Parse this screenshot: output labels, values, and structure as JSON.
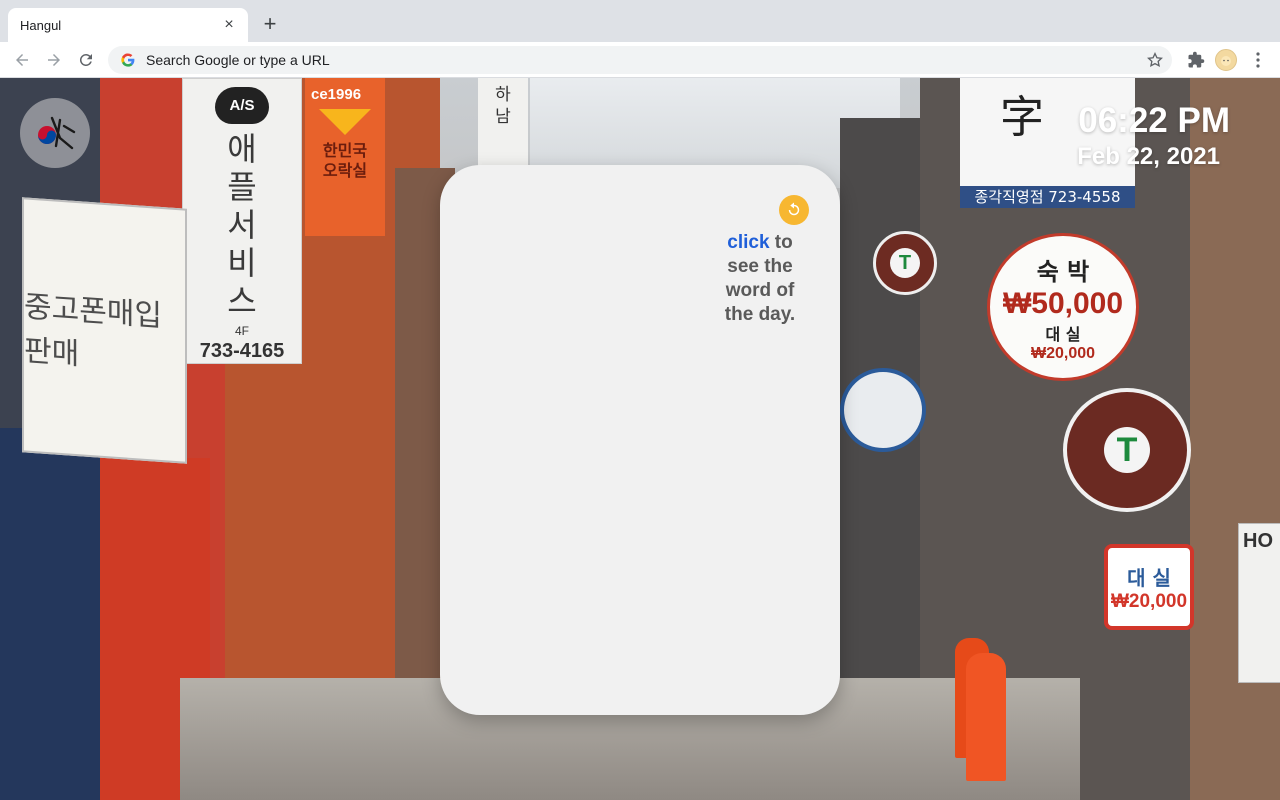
{
  "tab": {
    "title": "Hangul",
    "close_glyph": "×",
    "new_tab_glyph": "+"
  },
  "omnibox": {
    "placeholder": "Search Google or type a URL"
  },
  "toolbar_icons": [
    "back-icon",
    "forward-icon",
    "reload-icon",
    "google-g-icon",
    "star-icon",
    "puzzle-icon",
    "avatar",
    "menu-dots-icon"
  ],
  "colors": {
    "card_bg": "#f1f1f1",
    "link": "#1f5fd9",
    "refresh_bg": "#f7b731",
    "word_text": "#5a5a5a"
  },
  "clock": {
    "time": "06:22 PM",
    "date": "Feb 22, 2021"
  },
  "word_of_day": {
    "link": "click",
    "line1": "to",
    "line2": "see the",
    "line3": "word of",
    "line4": "the day."
  },
  "background_signs": {
    "apple_badge": "A/S",
    "apple_kr": [
      "애",
      "플",
      "서",
      "비",
      "스"
    ],
    "apple_floor": "4F",
    "apple_phone": "733-4165",
    "orange_top": "ce1996",
    "orange_kr": [
      "한민국",
      "오락실"
    ],
    "phone_shop": "중고폰매입판매",
    "hanam": [
      "하",
      "남"
    ],
    "black_phone": "종각직영점 723-4558",
    "hotel_label": "숙 박",
    "hotel_price": "₩50,000",
    "hotel_room": "대 실",
    "hotel_room_price": "₩20,000",
    "room_sign_kr": "대 실",
    "room_sign_price": "₩20,000",
    "guest_sign": "HO"
  }
}
